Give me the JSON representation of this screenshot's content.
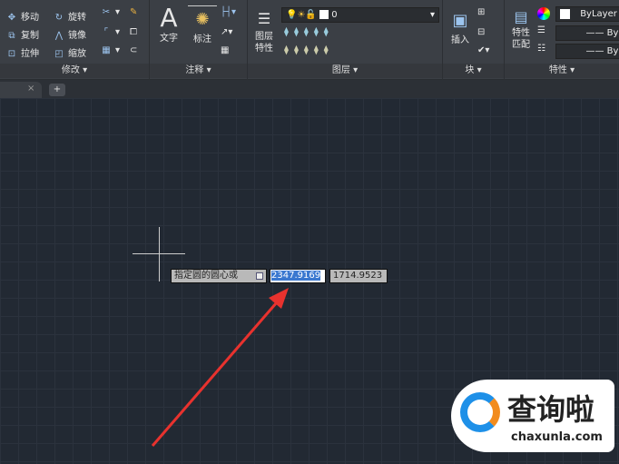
{
  "ribbon": {
    "modify": {
      "label": "修改 ▾",
      "move": "移动",
      "rotate": "旋转",
      "copy": "复制",
      "mirror": "镜像",
      "stretch": "拉伸",
      "scale": "缩放"
    },
    "annotation": {
      "label": "注释 ▾",
      "text": "文字",
      "dimension": "标注"
    },
    "layers": {
      "label": "图层 ▾",
      "layer_props": [
        "图层",
        "特性"
      ],
      "current_layer": "0"
    },
    "block": {
      "label": "块 ▾",
      "insert": "插入"
    },
    "properties": {
      "label": "特性 ▾",
      "match": [
        "特性",
        "匹配"
      ],
      "color": "ByLayer",
      "linetype": "ByL",
      "lineweight": "ByL"
    }
  },
  "tabs": {
    "close": "×",
    "add": "+"
  },
  "prompt": {
    "text": "指定圆的圆心或",
    "x_value": "2347.9169",
    "y_value": "1714.9523"
  },
  "watermark": {
    "name": "查询啦",
    "url": "chaxunla.com"
  },
  "colors": {
    "arrow": "#e8322e",
    "highlight": "#3a78d0"
  }
}
